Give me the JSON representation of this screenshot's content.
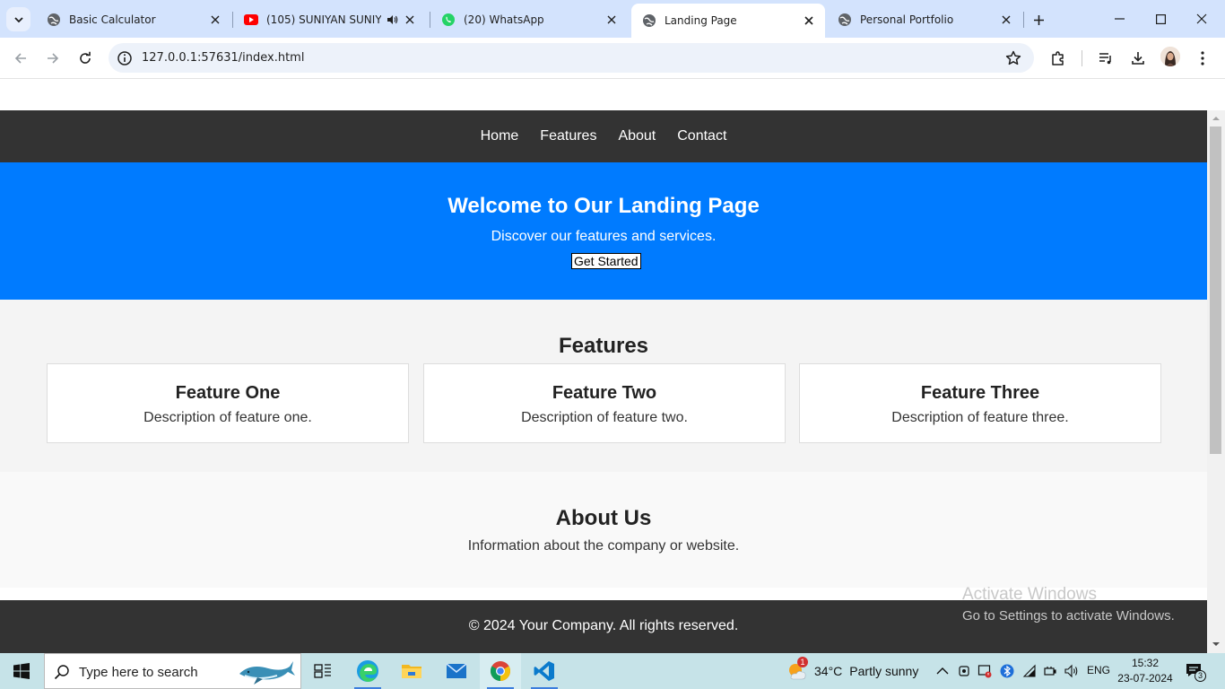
{
  "browser": {
    "tabs": [
      {
        "title": "Basic Calculator",
        "favicon": "globe-icon"
      },
      {
        "title": "(105) SUNIYAN SUNIYAN",
        "favicon": "youtube-icon",
        "audio": true
      },
      {
        "title": "(20) WhatsApp",
        "favicon": "whatsapp-icon"
      },
      {
        "title": "Landing Page",
        "favicon": "globe-icon",
        "active": true
      },
      {
        "title": "Personal Portfolio",
        "favicon": "globe-icon"
      }
    ],
    "url": "127.0.0.1:57631/index.html"
  },
  "page": {
    "nav": [
      "Home",
      "Features",
      "About",
      "Contact"
    ],
    "hero": {
      "title": "Welcome to Our Landing Page",
      "subtitle": "Discover our features and services.",
      "cta": "Get Started"
    },
    "features": {
      "heading": "Features",
      "items": [
        {
          "title": "Feature One",
          "desc": "Description of feature one."
        },
        {
          "title": "Feature Two",
          "desc": "Description of feature two."
        },
        {
          "title": "Feature Three",
          "desc": "Description of feature three."
        }
      ]
    },
    "about": {
      "heading": "About Us",
      "text": "Information about the company or website."
    },
    "footer": "© 2024 Your Company. All rights reserved."
  },
  "watermark": {
    "line1": "Activate Windows",
    "line2": "Go to Settings to activate Windows."
  },
  "taskbar": {
    "search_placeholder": "Type here to search",
    "weather_temp": "34°C",
    "weather_condition": "Partly sunny",
    "weather_badge": "1",
    "language": "ENG",
    "time": "15:32",
    "date": "23-07-2024",
    "notification_count": "3"
  },
  "colors": {
    "nav_bg": "#333333",
    "hero_bg": "#007bff",
    "features_bg": "#f4f4f4",
    "about_bg": "#f9f9f9",
    "tabstrip_bg": "#d3e3fd",
    "taskbar_bg": "#c6e3e8"
  }
}
